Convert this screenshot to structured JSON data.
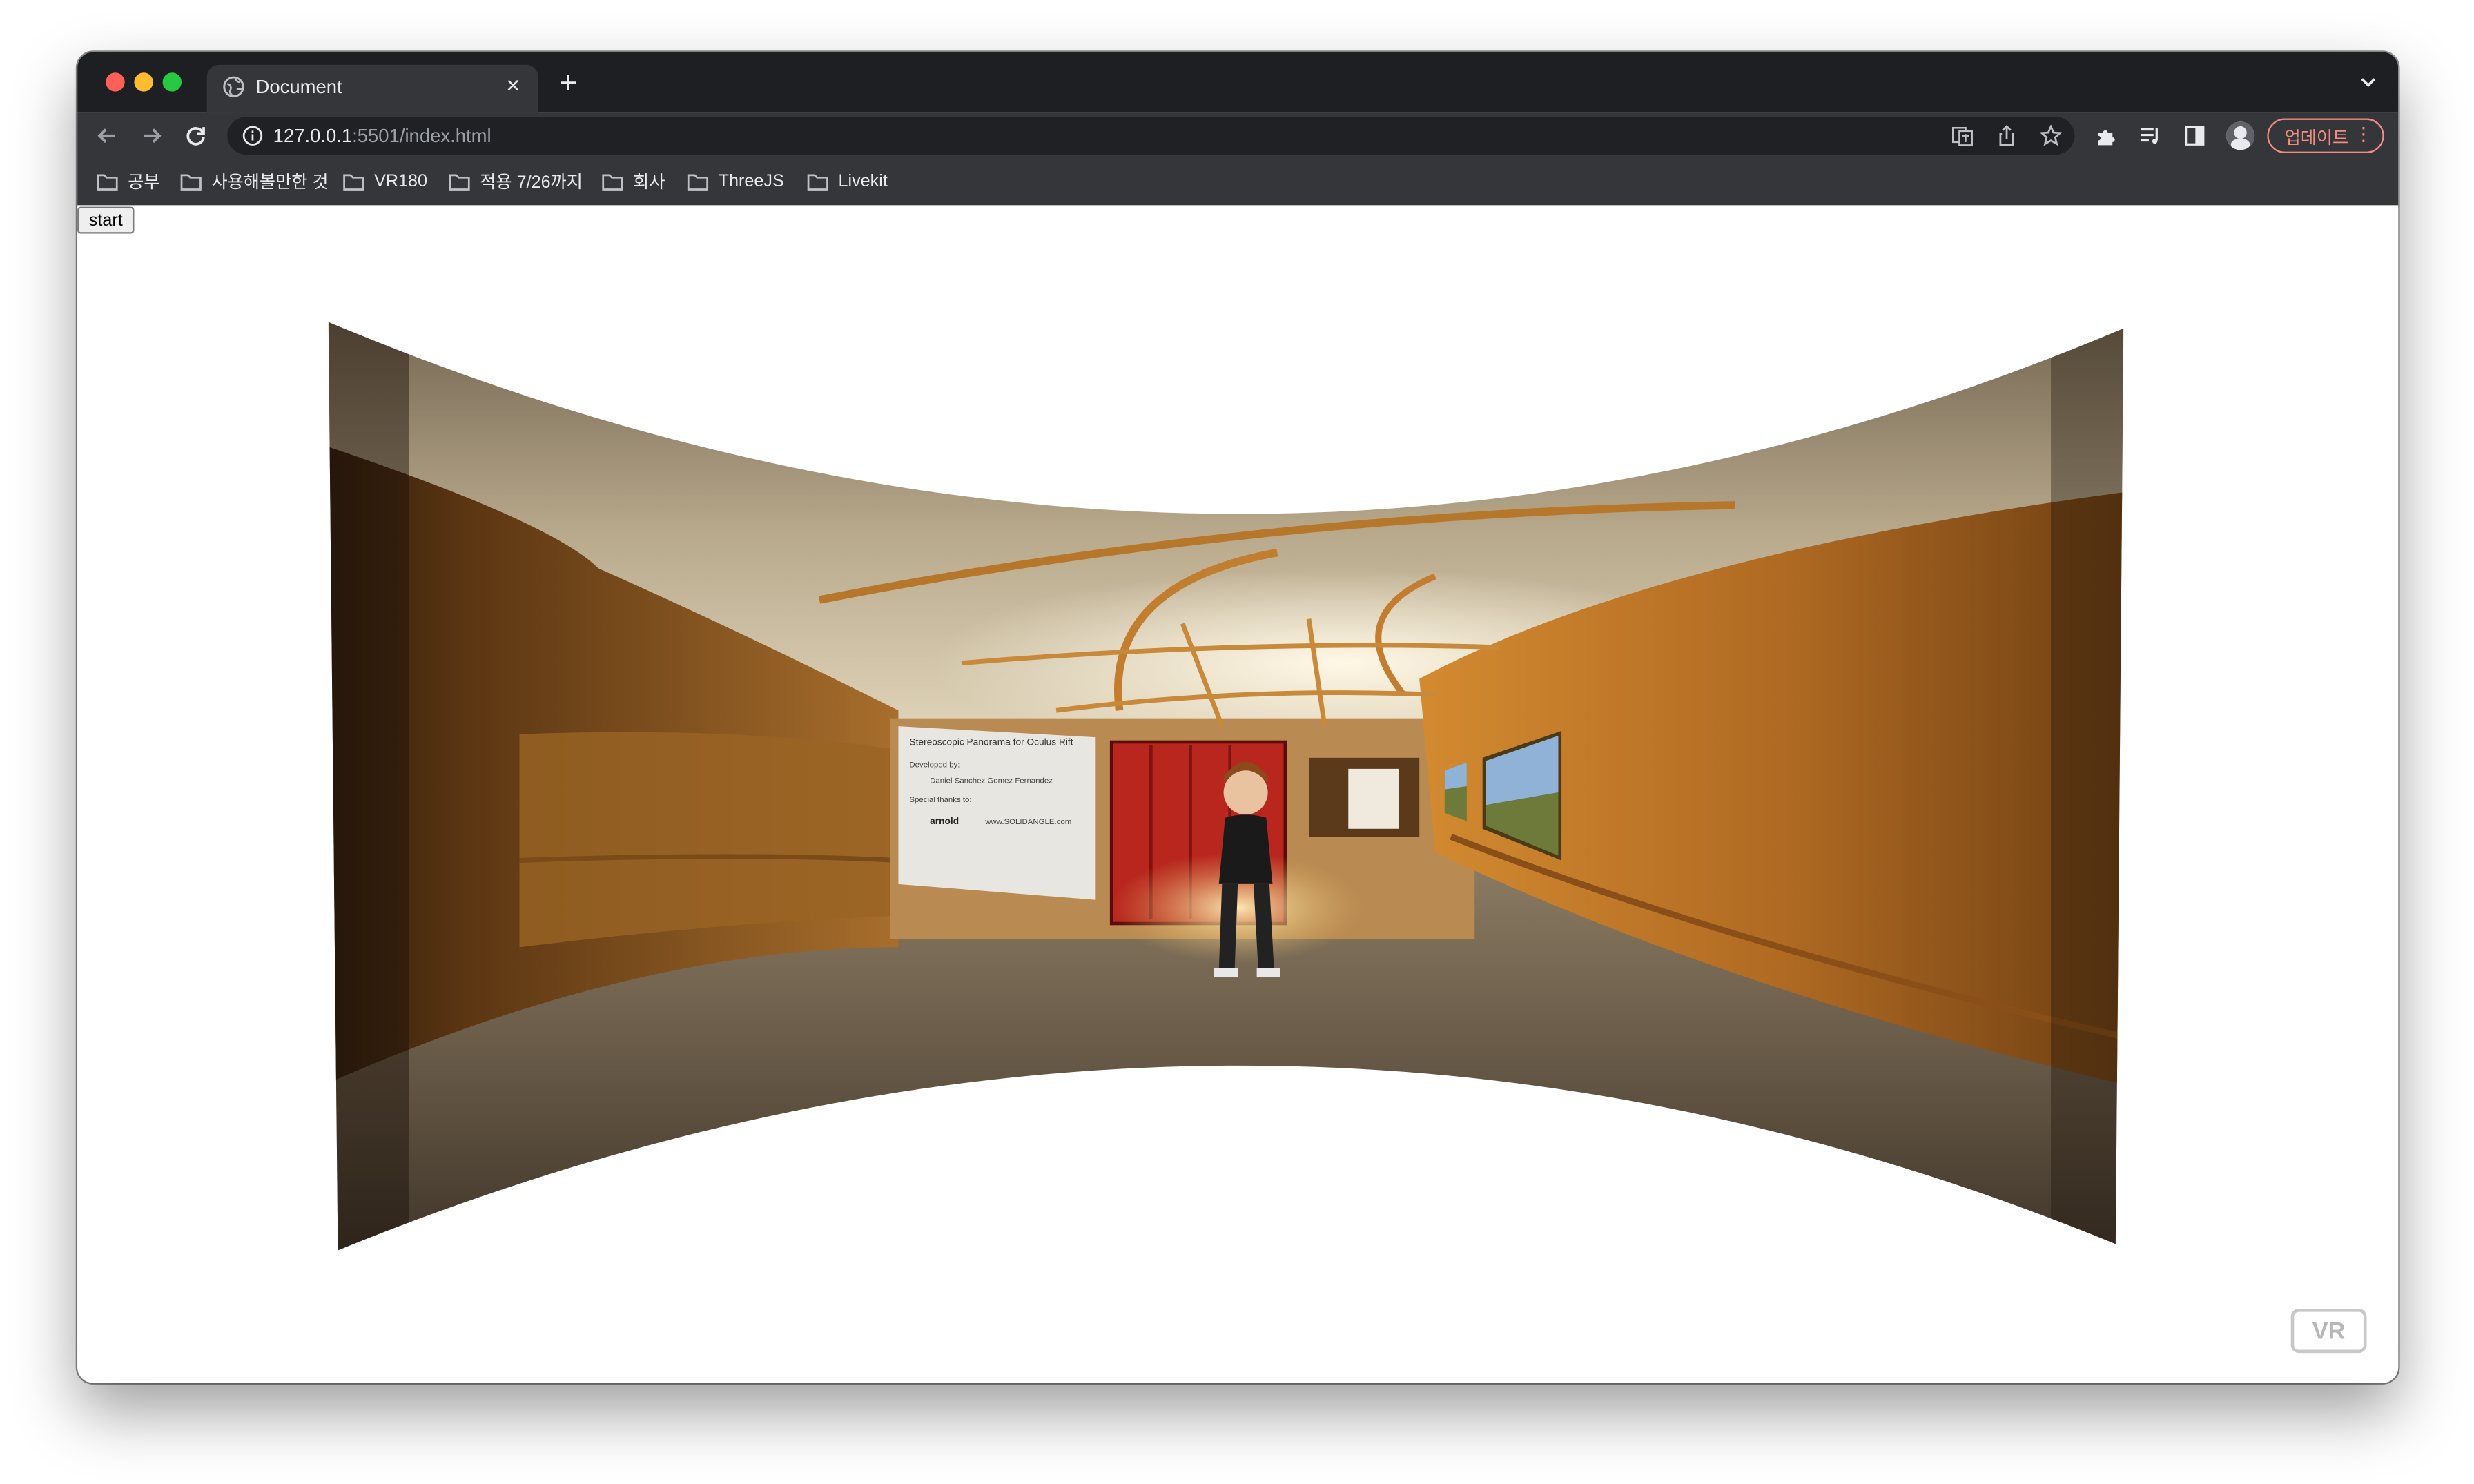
{
  "browser": {
    "tab": {
      "title": "Document",
      "close": "×"
    },
    "new_tab": "+",
    "address": {
      "host": "127.0.0.1",
      "rest": ":5501/index.html"
    },
    "update_button": {
      "label": "업데이트",
      "menu": "⋮"
    }
  },
  "bookmarks": [
    {
      "label": "공부"
    },
    {
      "label": "사용해볼만한 것"
    },
    {
      "label": "VR180"
    },
    {
      "label": "적용 7/26까지"
    },
    {
      "label": "회사"
    },
    {
      "label": "ThreeJS"
    },
    {
      "label": "Livekit"
    }
  ],
  "page": {
    "start_button": "start",
    "vr_button": "VR",
    "panorama": {
      "poster_title": "Stereoscopic Panorama for Oculus Rift",
      "poster_lines": [
        "Developed by:",
        "Daniel Sanchez Gomez Fernandez",
        "Special thanks to:",
        "arnold",
        "www.SOLIDANGLE.com"
      ]
    }
  },
  "colors": {
    "tabstrip": "#1e1f22",
    "toolbar": "#35363a",
    "omnibox": "#202124",
    "accent_update": "#f28b82",
    "wall_orange": "#c47a2c",
    "locker_red": "#b8261e"
  }
}
